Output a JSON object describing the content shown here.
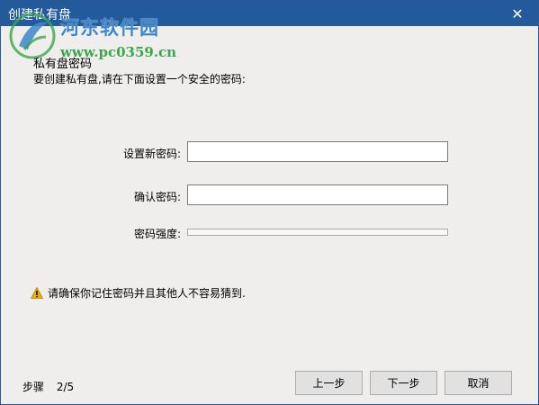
{
  "window": {
    "title": "创建私有盘",
    "close_glyph": "✕"
  },
  "watermark": {
    "site_name": "河东软件园",
    "url": "www.pc0359.cn"
  },
  "section": {
    "title": "私有盘密码",
    "description": "要创建私有盘,请在下面设置一个安全的密码:"
  },
  "form": {
    "new_password_label": "设置新密码:",
    "new_password_value": "",
    "confirm_password_label": "确认密码:",
    "confirm_password_value": "",
    "strength_label": "密码强度:",
    "strength_level": 0
  },
  "warning": {
    "icon": "warning-triangle-icon",
    "text": "请确保你记住密码并且其他人不容易猜到."
  },
  "footer": {
    "step_label": "步骤",
    "step_value": "2/5",
    "prev_label": "上一步",
    "next_label": "下一步",
    "cancel_label": "取消"
  },
  "colors": {
    "titlebar": "#235a9c",
    "background": "#f0eded",
    "warning_icon": "#e8b007"
  }
}
